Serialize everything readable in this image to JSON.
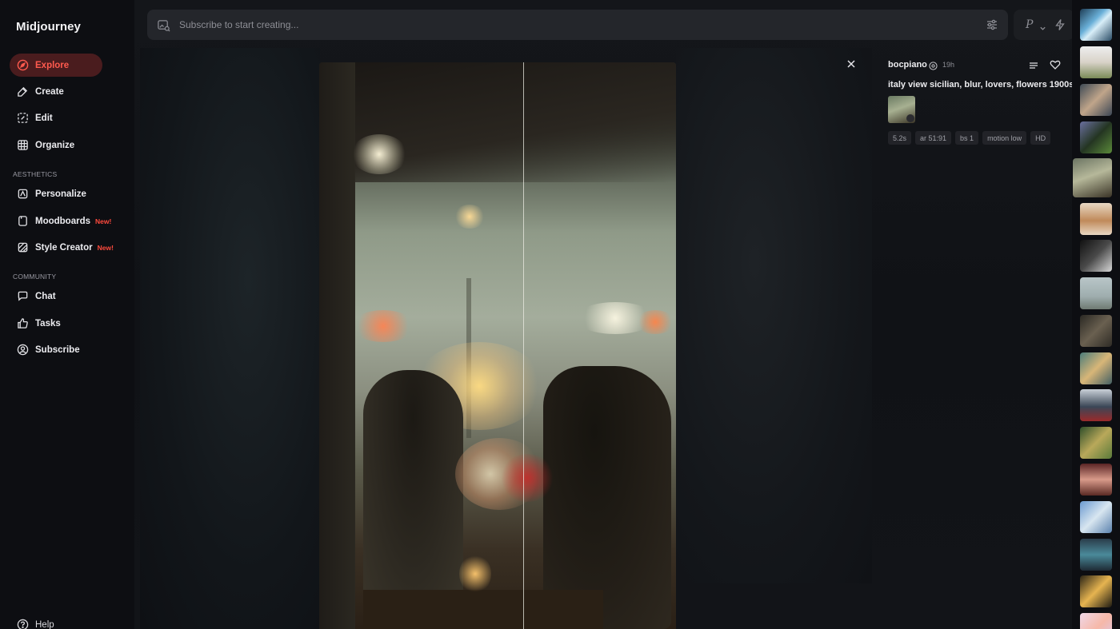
{
  "app": {
    "name": "Midjourney"
  },
  "sidebar": {
    "items": [
      {
        "label": "Explore",
        "icon": "compass-icon",
        "active": true
      },
      {
        "label": "Create",
        "icon": "brush-icon"
      },
      {
        "label": "Edit",
        "icon": "edit-frame-icon"
      },
      {
        "label": "Organize",
        "icon": "grid-icon"
      }
    ],
    "aesthetics_label": "AESTHETICS",
    "aesthetics_items": [
      {
        "label": "Personalize",
        "icon": "personalize-icon"
      },
      {
        "label": "Moodboards",
        "icon": "moodboard-icon",
        "badge": "New!"
      },
      {
        "label": "Style Creator",
        "icon": "style-creator-icon",
        "badge": "New!"
      }
    ],
    "community_label": "COMMUNITY",
    "community_items": [
      {
        "label": "Chat",
        "icon": "chat-icon"
      },
      {
        "label": "Tasks",
        "icon": "thumbs-up-icon"
      },
      {
        "label": "Subscribe",
        "icon": "user-circle-icon"
      }
    ],
    "help_label": "Help"
  },
  "search": {
    "placeholder": "Subscribe to start creating..."
  },
  "pbox": {
    "letter": "P"
  },
  "info": {
    "username": "bocpiano",
    "time": "19h",
    "prompt": "italy view sicilian, blur, lovers, flowers 1900s",
    "tags": [
      "5.2s",
      "ar 51:91",
      "bs 1",
      "motion low",
      "HD"
    ]
  },
  "colors": {
    "accent": "#ff5a4e",
    "active_bg": "#4a1c1e",
    "badge": "#ff4a3d"
  }
}
